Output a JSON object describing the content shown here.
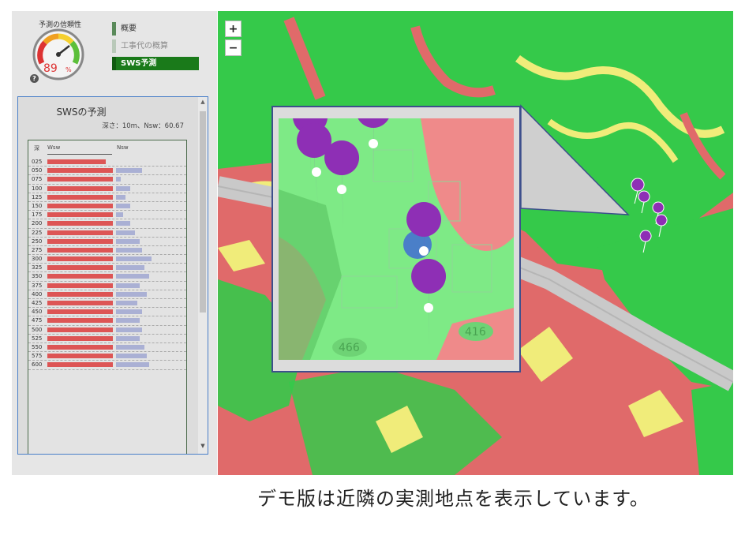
{
  "gauge": {
    "title": "予測の信頼性",
    "value": 89,
    "percent_text": "89",
    "percent_sign": "%",
    "help": "?"
  },
  "nav": {
    "items": [
      {
        "label": "概要",
        "state": "normal"
      },
      {
        "label": "工事代の概算",
        "state": "dim"
      },
      {
        "label": "SWS予測",
        "state": "active"
      }
    ]
  },
  "sws": {
    "title": "SWSの予測",
    "subtitle": "深さ：10m、Nsw：60.67",
    "headers": {
      "depth": "深",
      "wsw": "Wsw",
      "nsw": "Nsw"
    },
    "rows": [
      {
        "depth": "025",
        "wsw": 0.89,
        "nsw": 0.0
      },
      {
        "depth": "050",
        "wsw": 1.0,
        "nsw": 0.37
      },
      {
        "depth": "075",
        "wsw": 1.0,
        "nsw": 0.07
      },
      {
        "depth": "100",
        "wsw": 1.0,
        "nsw": 0.2
      },
      {
        "depth": "125",
        "wsw": 1.0,
        "nsw": 0.13
      },
      {
        "depth": "150",
        "wsw": 1.0,
        "nsw": 0.2
      },
      {
        "depth": "175",
        "wsw": 1.0,
        "nsw": 0.1
      },
      {
        "depth": "200",
        "wsw": 1.0,
        "nsw": 0.2
      },
      {
        "depth": "225",
        "wsw": 1.0,
        "nsw": 0.27
      },
      {
        "depth": "250",
        "wsw": 1.0,
        "nsw": 0.33
      },
      {
        "depth": "275",
        "wsw": 1.0,
        "nsw": 0.37
      },
      {
        "depth": "300",
        "wsw": 1.0,
        "nsw": 0.5
      },
      {
        "depth": "325",
        "wsw": 1.0,
        "nsw": 0.4
      },
      {
        "depth": "350",
        "wsw": 1.0,
        "nsw": 0.47
      },
      {
        "depth": "375",
        "wsw": 1.0,
        "nsw": 0.33
      },
      {
        "depth": "400",
        "wsw": 1.0,
        "nsw": 0.43
      },
      {
        "depth": "425",
        "wsw": 1.0,
        "nsw": 0.3
      },
      {
        "depth": "450",
        "wsw": 1.0,
        "nsw": 0.37
      },
      {
        "depth": "475",
        "wsw": 1.0,
        "nsw": 0.33
      },
      {
        "depth": "500",
        "wsw": 1.0,
        "nsw": 0.37
      },
      {
        "depth": "525",
        "wsw": 1.0,
        "nsw": 0.33
      },
      {
        "depth": "550",
        "wsw": 1.0,
        "nsw": 0.4
      },
      {
        "depth": "575",
        "wsw": 1.0,
        "nsw": 0.43
      },
      {
        "depth": "600",
        "wsw": 1.0,
        "nsw": 0.47
      }
    ],
    "scroll_up": "▲",
    "scroll_down": "▼"
  },
  "map": {
    "zoom_in": "+",
    "zoom_out": "−",
    "road_labels": [
      "466",
      "416"
    ],
    "colors": {
      "green": "#35c94a",
      "red": "#e06a6a",
      "yellow": "#f0ec7a",
      "road": "#c9c9c9",
      "pin": "#8e2fb5"
    }
  },
  "caption": "デモ版は近隣の実測地点を表示しています。"
}
